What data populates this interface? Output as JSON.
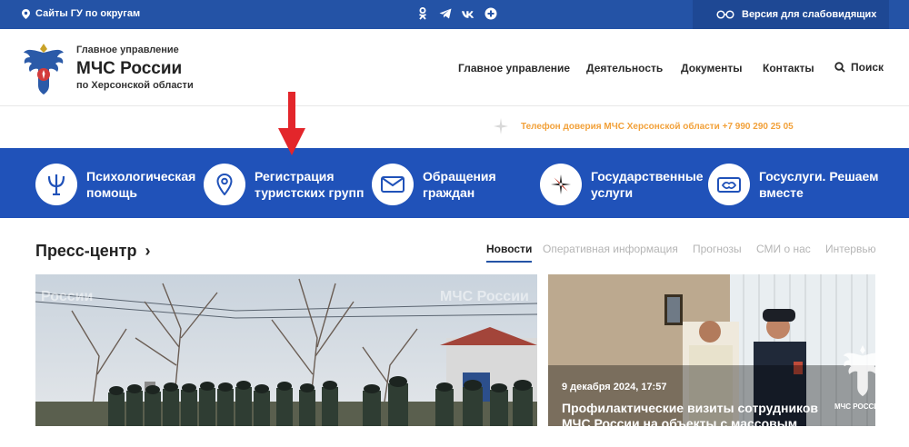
{
  "topbar": {
    "sites_label": "Сайты ГУ по округам",
    "social_icons": [
      "odnoklassniki-icon",
      "telegram-icon",
      "vk-icon",
      "plus-icon"
    ],
    "vision_label": "Версия для слабовидящих"
  },
  "header": {
    "brand_top": "Главное управление",
    "brand_main": "МЧС России",
    "brand_sub": "по Херсонской области",
    "nav": [
      "Главное управление",
      "Деятельность",
      "Документы",
      "Контакты"
    ],
    "search_label": "Поиск"
  },
  "hotline": "Телефон доверия МЧС Херсонской области +7 990 290 25 05",
  "services": [
    {
      "line1": "Психологическая",
      "line2": "помощь",
      "icon": "psi-icon"
    },
    {
      "line1": "Регистрация",
      "line2": "туристских групп",
      "icon": "map-pin-icon"
    },
    {
      "line1": "Обращения",
      "line2": "граждан",
      "icon": "envelope-icon"
    },
    {
      "line1": "Государственные",
      "line2": "услуги",
      "icon": "compass-icon"
    },
    {
      "line1": "Госуслуги. Решаем",
      "line2": "вместе",
      "icon": "gosuslugi-icon"
    }
  ],
  "press": {
    "title": "Пресс-центр",
    "chevron": "›",
    "tabs": [
      "Новости",
      "Оперативная информация",
      "Прогнозы",
      "СМИ о нас",
      "Интервью"
    ],
    "active_tab": 0
  },
  "news": {
    "left_watermark": [
      "России",
      "МЧС России"
    ],
    "date": "9 декабря 2024, 17:57",
    "title": "Профилактические визиты сотрудников МЧС России на объекты с массовым пребыванием"
  },
  "watermark": "МЧС РОССИИ",
  "colors": {
    "topbar": "#2453a6",
    "services_band": "#2052b9",
    "hotline": "#f2a13a",
    "arrow": "#e3262b",
    "active_tab_underline": "#2453a6"
  }
}
